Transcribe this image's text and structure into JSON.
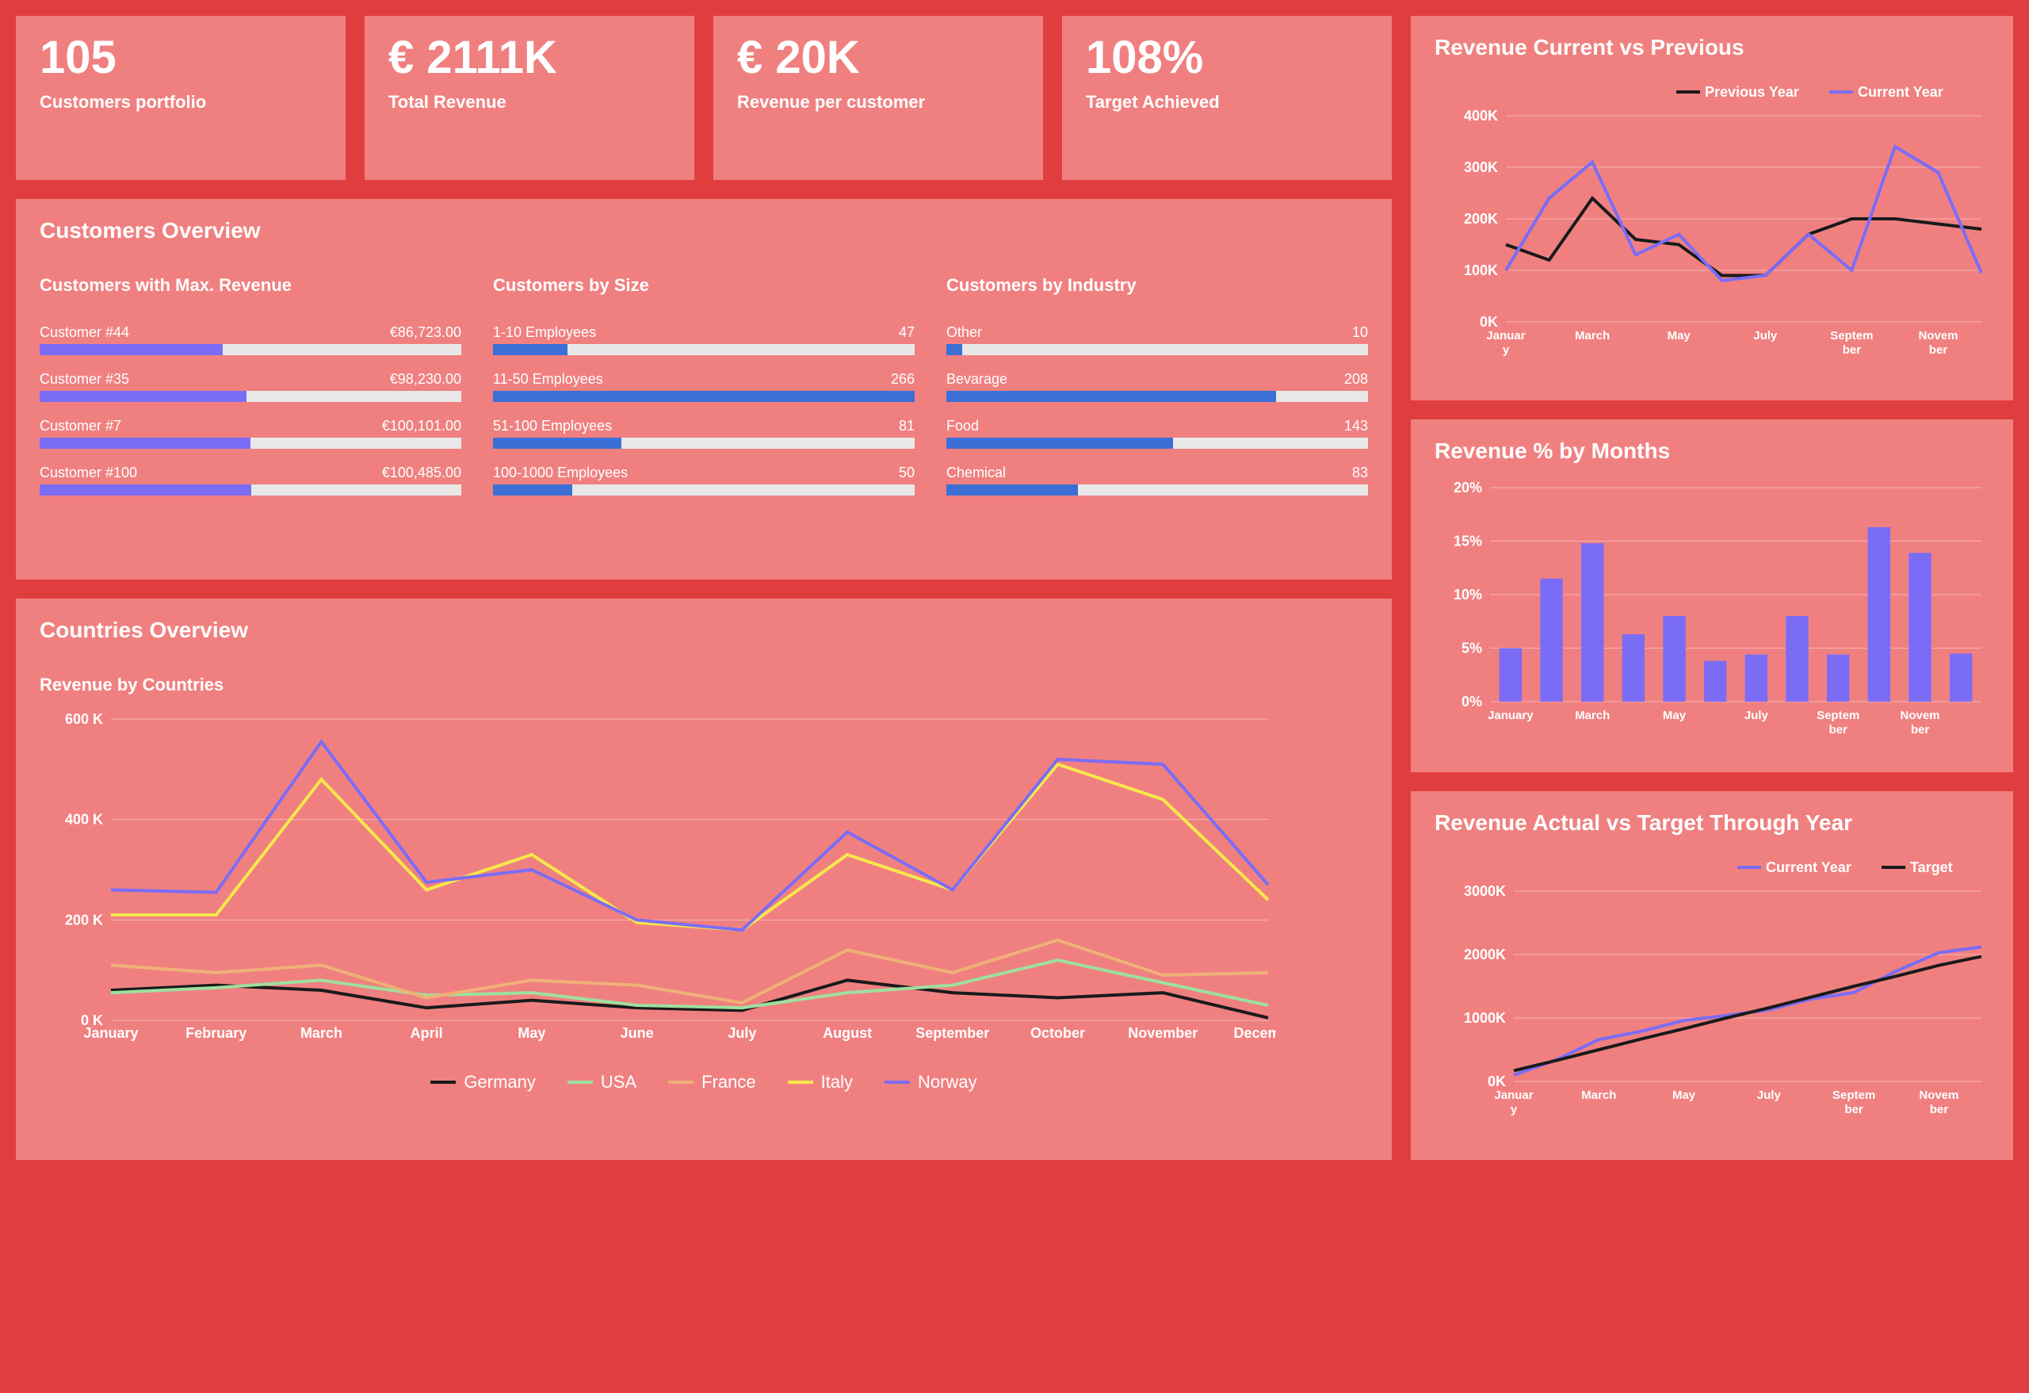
{
  "kpis": [
    {
      "value": "105",
      "label": "Customers portfolio"
    },
    {
      "value": "€ 2111K",
      "label": "Total Revenue"
    },
    {
      "value": "€ 20K",
      "label": "Revenue per customer"
    },
    {
      "value": "108%",
      "label": "Target Achieved"
    }
  ],
  "customers_overview": {
    "title": "Customers Overview",
    "max_revenue": {
      "title": "Customers with Max. Revenue",
      "max": 200000,
      "color": "#7b6cf6",
      "rows": [
        {
          "label": "Customer #44",
          "value_text": "€86,723.00",
          "value": 86723
        },
        {
          "label": "Customer #35",
          "value_text": "€98,230.00",
          "value": 98230
        },
        {
          "label": "Customer #7",
          "value_text": "€100,101.00",
          "value": 100101
        },
        {
          "label": "Customer #100",
          "value_text": "€100,485.00",
          "value": 100485
        }
      ]
    },
    "by_size": {
      "title": "Customers by Size",
      "max": 266,
      "color": "#3b6fd6",
      "rows": [
        {
          "label": "1-10 Employees",
          "value_text": "47",
          "value": 47
        },
        {
          "label": "11-50 Employees",
          "value_text": "266",
          "value": 266
        },
        {
          "label": "51-100 Employees",
          "value_text": "81",
          "value": 81
        },
        {
          "label": "100-1000 Employees",
          "value_text": "50",
          "value": 50
        }
      ]
    },
    "by_industry": {
      "title": "Customers by Industry",
      "max": 266,
      "color": "#3b6fd6",
      "rows": [
        {
          "label": "Other",
          "value_text": "10",
          "value": 10
        },
        {
          "label": "Bevarage",
          "value_text": "208",
          "value": 208
        },
        {
          "label": "Food",
          "value_text": "143",
          "value": 143
        },
        {
          "label": "Chemical",
          "value_text": "83",
          "value": 83
        }
      ]
    }
  },
  "countries_overview": {
    "title": "Countries Overview",
    "subtitle": "Revenue by Countries"
  },
  "right": {
    "rev_vs_prev_title": "Revenue Current vs Previous",
    "rev_pct_title": "Revenue % by Months",
    "actual_vs_target_title": "Revenue Actual vs Target Through Year",
    "legend_previous": "Previous Year",
    "legend_current": "Current Year",
    "legend_target": "Target"
  },
  "colors": {
    "black": "#1a1a1a",
    "violet": "#7b6cf6",
    "green": "#9ee09e",
    "orange": "#f0b077",
    "yellow": "#f7e84b",
    "blue": "#3b6fd6"
  },
  "chart_data": [
    {
      "id": "revenue_vs_previous",
      "type": "line",
      "title": "Revenue Current vs Previous",
      "xlabel": "",
      "ylabel": "",
      "ylim": [
        0,
        400000
      ],
      "yticks": [
        "0K",
        "100K",
        "200K",
        "300K",
        "400K"
      ],
      "categories": [
        "January",
        "February",
        "March",
        "April",
        "May",
        "June",
        "July",
        "August",
        "September",
        "October",
        "November",
        "December"
      ],
      "xtick_labels": [
        "Januar y",
        "",
        "March",
        "",
        "May",
        "",
        "July",
        "",
        "Septem ber",
        "",
        "Novem ber",
        ""
      ],
      "series": [
        {
          "name": "Previous Year",
          "color": "#1a1a1a",
          "values": [
            150000,
            120000,
            240000,
            160000,
            150000,
            90000,
            90000,
            170000,
            200000,
            200000,
            190000,
            180000
          ]
        },
        {
          "name": "Current Year",
          "color": "#7b6cf6",
          "values": [
            100000,
            240000,
            310000,
            130000,
            170000,
            80000,
            90000,
            170000,
            100000,
            340000,
            290000,
            95000
          ]
        }
      ]
    },
    {
      "id": "revenue_pct_months",
      "type": "bar",
      "title": "Revenue % by Months",
      "xlabel": "",
      "ylabel": "",
      "ylim": [
        0,
        20
      ],
      "yticks": [
        "0%",
        "5%",
        "10%",
        "15%",
        "20%"
      ],
      "categories": [
        "January",
        "February",
        "March",
        "April",
        "May",
        "June",
        "July",
        "August",
        "September",
        "October",
        "November",
        "December"
      ],
      "xtick_labels": [
        "January",
        "",
        "March",
        "",
        "May",
        "",
        "July",
        "",
        "Septem ber",
        "",
        "Novem ber",
        ""
      ],
      "values": [
        5.0,
        11.5,
        14.8,
        6.3,
        8.0,
        3.8,
        4.4,
        8.0,
        4.4,
        16.3,
        13.9,
        4.5
      ],
      "bar_color": "#7b6cf6"
    },
    {
      "id": "actual_vs_target",
      "type": "line",
      "title": "Revenue Actual vs Target Through Year",
      "xlabel": "",
      "ylabel": "",
      "ylim": [
        0,
        3000000
      ],
      "yticks": [
        "0K",
        "1000K",
        "2000K",
        "3000K"
      ],
      "categories": [
        "January",
        "February",
        "March",
        "April",
        "May",
        "June",
        "July",
        "August",
        "September",
        "October",
        "November",
        "December"
      ],
      "xtick_labels": [
        "Januar y",
        "",
        "March",
        "",
        "May",
        "",
        "July",
        "",
        "Septem ber",
        "",
        "Novem ber",
        ""
      ],
      "series": [
        {
          "name": "Current Year",
          "color": "#7b6cf6",
          "values": [
            100000,
            340000,
            660000,
            790000,
            960000,
            1040000,
            1130000,
            1300000,
            1400000,
            1740000,
            2030000,
            2120000
          ]
        },
        {
          "name": "Target",
          "color": "#1a1a1a",
          "values": [
            170000,
            330000,
            500000,
            670000,
            830000,
            1000000,
            1160000,
            1330000,
            1500000,
            1660000,
            1830000,
            1970000
          ]
        }
      ]
    },
    {
      "id": "revenue_by_countries",
      "type": "line",
      "title": "Revenue by Countries",
      "xlabel": "",
      "ylabel": "",
      "ylim": [
        0,
        600000
      ],
      "yticks": [
        "0 K",
        "200 K",
        "400 K",
        "600 K"
      ],
      "categories": [
        "January",
        "February",
        "March",
        "April",
        "May",
        "June",
        "July",
        "August",
        "September",
        "October",
        "November",
        "December"
      ],
      "series": [
        {
          "name": "Germany",
          "color": "#1a1a1a",
          "values": [
            60000,
            70000,
            60000,
            25000,
            40000,
            25000,
            20000,
            80000,
            55000,
            45000,
            55000,
            5000
          ]
        },
        {
          "name": "USA",
          "color": "#9ee09e",
          "values": [
            55000,
            65000,
            80000,
            50000,
            55000,
            30000,
            25000,
            55000,
            70000,
            120000,
            75000,
            30000
          ]
        },
        {
          "name": "France",
          "color": "#f0b077",
          "values": [
            110000,
            95000,
            110000,
            45000,
            80000,
            70000,
            35000,
            140000,
            95000,
            160000,
            90000,
            95000
          ]
        },
        {
          "name": "Italy",
          "color": "#f7e84b",
          "values": [
            210000,
            210000,
            480000,
            260000,
            330000,
            195000,
            180000,
            330000,
            260000,
            510000,
            440000,
            240000
          ]
        },
        {
          "name": "Norway",
          "color": "#7b6cf6",
          "values": [
            260000,
            255000,
            555000,
            275000,
            300000,
            200000,
            180000,
            375000,
            260000,
            520000,
            510000,
            270000
          ]
        }
      ]
    }
  ]
}
